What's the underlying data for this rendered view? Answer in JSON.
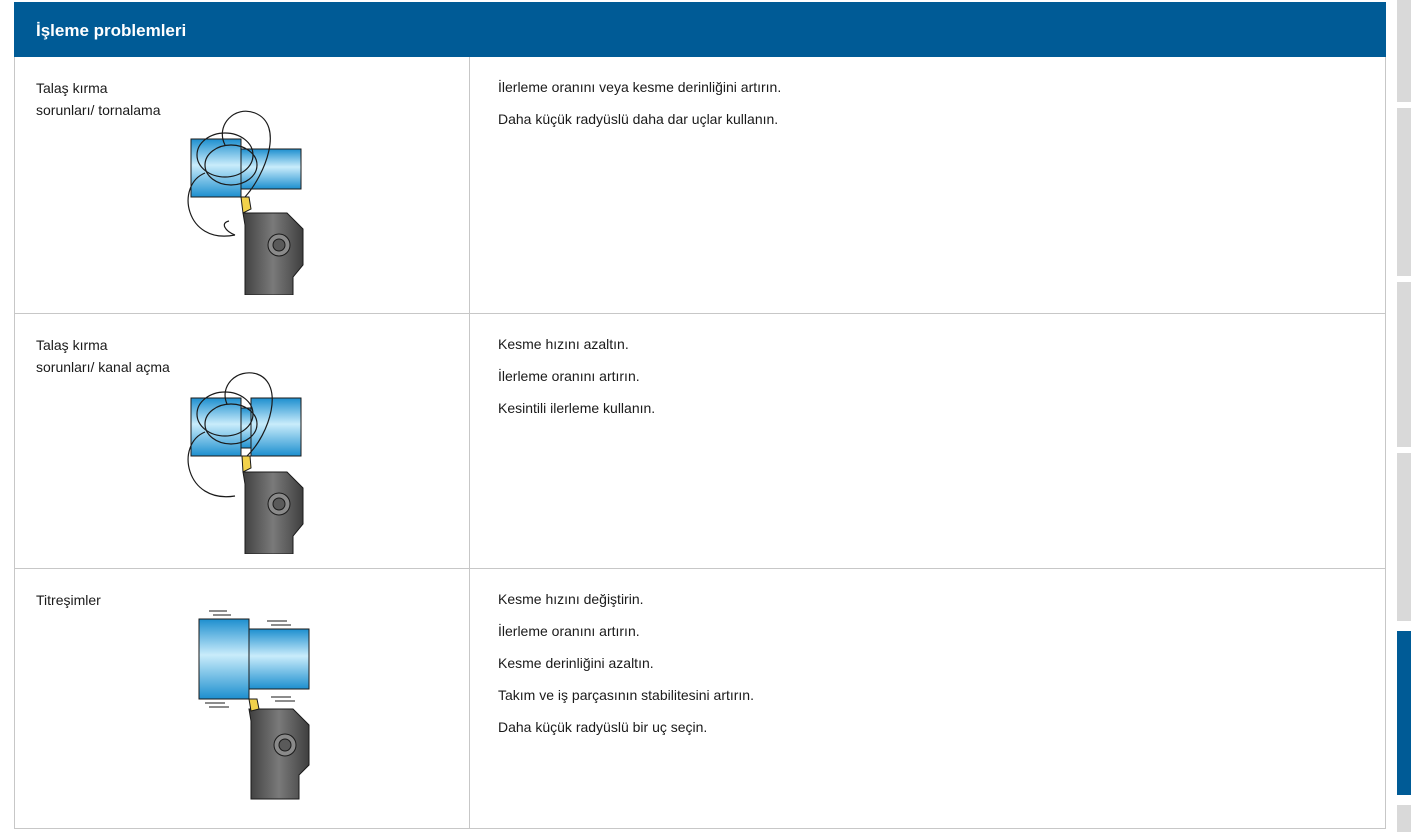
{
  "header": {
    "title": "İşleme problemleri"
  },
  "rows": [
    {
      "problem_line1": "Talaş kırma",
      "problem_line2": "sorunları/ tornalama",
      "solutions": [
        "İlerleme oranını veya kesme derinliğini artırın.",
        "Daha küçük radyüslü daha dar uçlar kullanın."
      ]
    },
    {
      "problem_line1": "Talaş kırma",
      "problem_line2": "sorunları/ kanal açma",
      "solutions": [
        "Kesme hızını azaltın.",
        "İlerleme oranını artırın.",
        "Kesintili ilerleme kullanın."
      ]
    },
    {
      "problem_line1": "Titreşimler",
      "solutions": [
        "Kesme hızını değiştirin.",
        "İlerleme oranını artırın.",
        "Kesme derinliğini azaltın.",
        "Takım ve iş parçasının stabilitesini artırın.",
        "Daha küçük radyüslü bir uç seçin."
      ]
    }
  ],
  "colors": {
    "header": "#005b96",
    "workpiece": "#36a9e1",
    "tool_holder": "#595959",
    "insert": "#f2d24b"
  }
}
